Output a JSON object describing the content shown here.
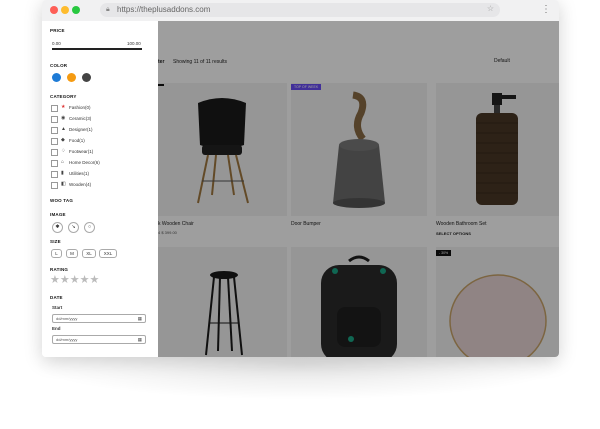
{
  "browser": {
    "url": "https://theplusaddons.com"
  },
  "toolbar": {
    "partial_label": "ter",
    "results_text": "Showing 11 of 11 results",
    "sort_value": "Default"
  },
  "products": [
    {
      "title": "k Wooden Chair",
      "price": "4 $ 399.00",
      "badge": "",
      "button": ""
    },
    {
      "title": "Door Bumper",
      "price": "",
      "badge": "TOP OF WEEK",
      "button": ""
    },
    {
      "title": "Wooden Bathroom Set",
      "price": "",
      "badge": "",
      "button": "SELECT OPTIONS"
    }
  ],
  "bottom_badge": "- 30%",
  "sidebar": {
    "price": {
      "label": "PRICE",
      "min": "0.00",
      "max": "100.00"
    },
    "color": {
      "label": "COLOR",
      "swatches": [
        "#1e7bd6",
        "#f59b12",
        "#444444"
      ]
    },
    "category": {
      "label": "CATEGORY",
      "items": [
        {
          "icon": "★",
          "label": "Fashion(0)"
        },
        {
          "icon": "◉",
          "label": "Ceramic(3)"
        },
        {
          "icon": "▲",
          "label": "Designer(1)"
        },
        {
          "icon": "◆",
          "label": "Food(1)"
        },
        {
          "icon": "♢",
          "label": "Footwear(1)"
        },
        {
          "icon": "⌂",
          "label": "Home Decor(6)"
        },
        {
          "icon": "▮",
          "label": "Utilities(1)"
        },
        {
          "icon": "◧",
          "label": "Wooden(4)"
        }
      ]
    },
    "woo_tag": {
      "label": "WOO TAG"
    },
    "image": {
      "label": "IMAGE"
    },
    "size": {
      "label": "SIZE",
      "options": [
        "L",
        "M",
        "XL",
        "XXL"
      ]
    },
    "rating": {
      "label": "RATING",
      "stars": "★★★★★"
    },
    "date": {
      "label": "DATE",
      "start_label": "Start",
      "end_label": "End",
      "placeholder": "dd/mm/yyyy"
    }
  }
}
